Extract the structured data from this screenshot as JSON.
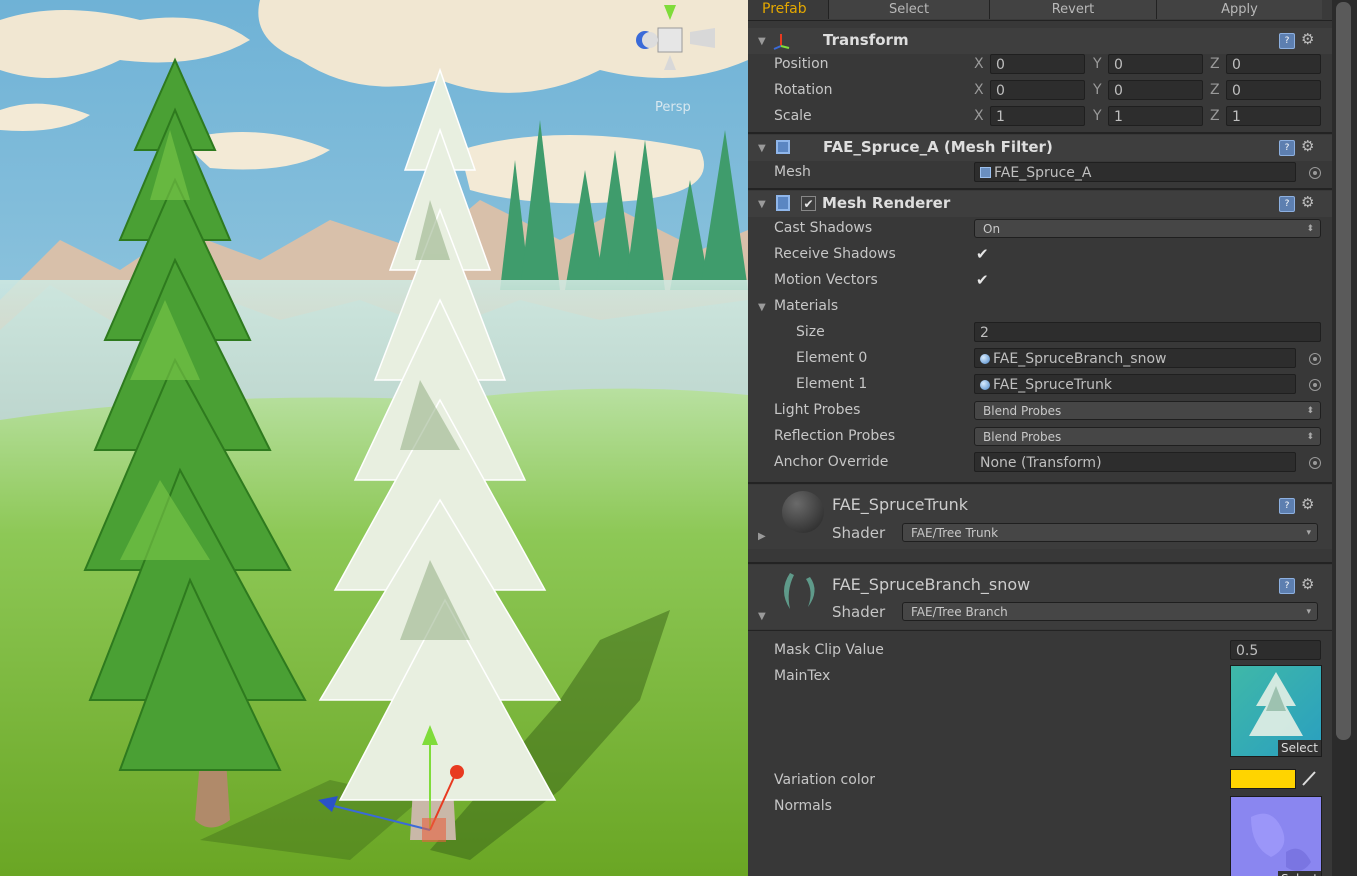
{
  "scene": {
    "persp_label": "Persp"
  },
  "prefab_bar": {
    "label": "Prefab",
    "select": "Select",
    "revert": "Revert",
    "apply": "Apply"
  },
  "transform": {
    "title": "Transform",
    "position": {
      "label": "Position",
      "x": "0",
      "y": "0",
      "z": "0"
    },
    "rotation": {
      "label": "Rotation",
      "x": "0",
      "y": "0",
      "z": "0"
    },
    "scale": {
      "label": "Scale",
      "x": "1",
      "y": "1",
      "z": "1"
    },
    "axis_x": "X",
    "axis_y": "Y",
    "axis_z": "Z"
  },
  "mesh_filter": {
    "title": "FAE_Spruce_A (Mesh Filter)",
    "mesh_label": "Mesh",
    "mesh_value": "FAE_Spruce_A"
  },
  "mesh_renderer": {
    "title": "Mesh Renderer",
    "cast_shadows_label": "Cast Shadows",
    "cast_shadows_value": "On",
    "receive_shadows_label": "Receive Shadows",
    "motion_vectors_label": "Motion Vectors",
    "materials_label": "Materials",
    "size_label": "Size",
    "size_value": "2",
    "element0_label": "Element 0",
    "element0_value": "FAE_SpruceBranch_snow",
    "element1_label": "Element 1",
    "element1_value": "FAE_SpruceTrunk",
    "light_probes_label": "Light Probes",
    "light_probes_value": "Blend Probes",
    "reflection_probes_label": "Reflection Probes",
    "reflection_probes_value": "Blend Probes",
    "anchor_override_label": "Anchor Override",
    "anchor_override_value": "None (Transform)"
  },
  "material_trunk": {
    "name": "FAE_SpruceTrunk",
    "shader_label": "Shader",
    "shader_value": "FAE/Tree Trunk"
  },
  "material_branch": {
    "name": "FAE_SpruceBranch_snow",
    "shader_label": "Shader",
    "shader_value": "FAE/Tree Branch",
    "mask_clip_label": "Mask Clip Value",
    "mask_clip_value": "0.5",
    "maintex_label": "MainTex",
    "select_label": "Select",
    "variation_label": "Variation color",
    "variation_color": "#ffd400",
    "normals_label": "Normals"
  },
  "colors": {
    "accent_prefab": "#e4a800",
    "panel": "#383838"
  }
}
